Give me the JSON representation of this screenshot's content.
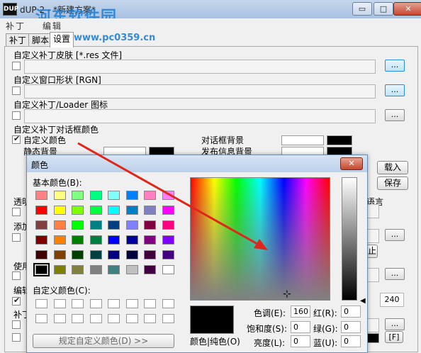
{
  "window": {
    "title": "dUP 2 - *新建方案*",
    "buttons": {
      "minimize": "▭",
      "maximize": "□",
      "close": "✕"
    }
  },
  "watermark": {
    "text": "河东软件园",
    "url": "www.pc0359.cn"
  },
  "menu": [
    "补",
    "丁",
    "编",
    "辑"
  ],
  "tabs": [
    {
      "label": "补丁",
      "active": false
    },
    {
      "label": "脚本",
      "active": false
    },
    {
      "label": "设置",
      "active": true
    }
  ],
  "settings": {
    "skin": {
      "label": "自定义补丁皮肤 [*.res 文件]",
      "checked": false,
      "button": "..."
    },
    "window_shape": {
      "label": "自定义窗口形状 [RGN]",
      "checked": false,
      "button": "..."
    },
    "loader_icon": {
      "label": "自定义补丁/Loader 图标",
      "checked": false,
      "button": "..."
    },
    "dialog_colors": {
      "group_label": "自定义补丁对话框颜色",
      "custom_color": {
        "label": "自定义颜色",
        "checked": true
      },
      "static_bg": "静态背景",
      "dialog_box": "对话框背景",
      "publish_bg": "发布信息背景",
      "load_button": "载入",
      "save_button": "保存"
    },
    "partial_labels": {
      "transparency": "透明",
      "add": "添加",
      "use": "使用",
      "edit": "编辑",
      "patch": "补丁",
      "language": "语言",
      "stop": "止"
    },
    "right_values": {
      "number": "240",
      "f_button": "[F]"
    }
  },
  "color_dialog": {
    "title": "颜色",
    "close": "✕",
    "basic_colors_label": "基本颜色(B):",
    "custom_colors_label": "自定义颜色(C):",
    "define_custom_button": "规定自定义颜色(D) >>",
    "color_solid_label": "颜色|纯色(O)",
    "fields": {
      "hue": {
        "label": "色调(E):",
        "value": "160"
      },
      "sat": {
        "label": "饱和度(S):",
        "value": "0"
      },
      "lum": {
        "label": "亮度(L):",
        "value": "0"
      },
      "red": {
        "label": "红(R):",
        "value": "0"
      },
      "green": {
        "label": "绿(G):",
        "value": "0"
      },
      "blue": {
        "label": "蓝(U):",
        "value": "0"
      }
    },
    "basic_colors": [
      [
        "#ff8080",
        "#ffff80",
        "#80ff80",
        "#00ff80",
        "#80ffff",
        "#0080ff",
        "#ff80c0",
        "#ff80ff"
      ],
      [
        "#ff0000",
        "#ffff00",
        "#80ff00",
        "#00ff40",
        "#00ffff",
        "#0080c0",
        "#8080c0",
        "#ff00ff"
      ],
      [
        "#804040",
        "#ff8040",
        "#00ff00",
        "#008080",
        "#004080",
        "#8080ff",
        "#800040",
        "#ff0080"
      ],
      [
        "#800000",
        "#ff8000",
        "#008000",
        "#008040",
        "#0000ff",
        "#0000a0",
        "#800080",
        "#8000ff"
      ],
      [
        "#400000",
        "#804000",
        "#004000",
        "#004040",
        "#000080",
        "#000040",
        "#400040",
        "#400080"
      ],
      [
        "#000000",
        "#808000",
        "#808040",
        "#808080",
        "#408080",
        "#c0c0c0",
        "#400040",
        "#ffffff"
      ]
    ]
  }
}
